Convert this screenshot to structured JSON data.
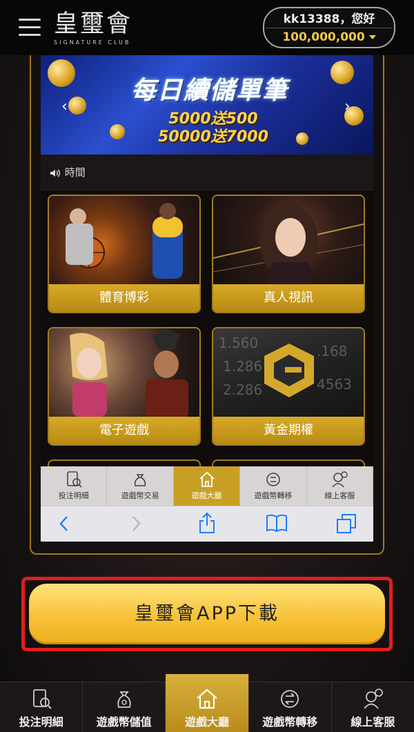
{
  "header": {
    "logo_cn": "皇璽會",
    "logo_en": "SIGNATURE CLUB",
    "username": "kk13388，您好",
    "balance": "100,000,000"
  },
  "banner": {
    "title": "每日續儲單筆",
    "line1": "5000送500",
    "line2": "50000送7000"
  },
  "notice": {
    "text": "時間"
  },
  "games": [
    {
      "label": "體育博彩"
    },
    {
      "label": "真人視訊"
    },
    {
      "label": "電子遊戲"
    },
    {
      "label": "黃金期權"
    }
  ],
  "inner_tabs": [
    {
      "label": "投注明細"
    },
    {
      "label": "遊戲幣交易"
    },
    {
      "label": "遊戲大廳"
    },
    {
      "label": "遊戲幣轉移"
    },
    {
      "label": "線上客服"
    }
  ],
  "download": {
    "label": "皇璽會APP下載"
  },
  "bottom_nav": [
    {
      "label": "投注明細"
    },
    {
      "label": "遊戲幣儲值"
    },
    {
      "label": "遊戲大廳"
    },
    {
      "label": "遊戲幣轉移"
    },
    {
      "label": "線上客服"
    }
  ],
  "colors": {
    "gold": "#c9a026",
    "highlight_red": "#e21d1d",
    "button_yellow": "#f7c23a"
  }
}
